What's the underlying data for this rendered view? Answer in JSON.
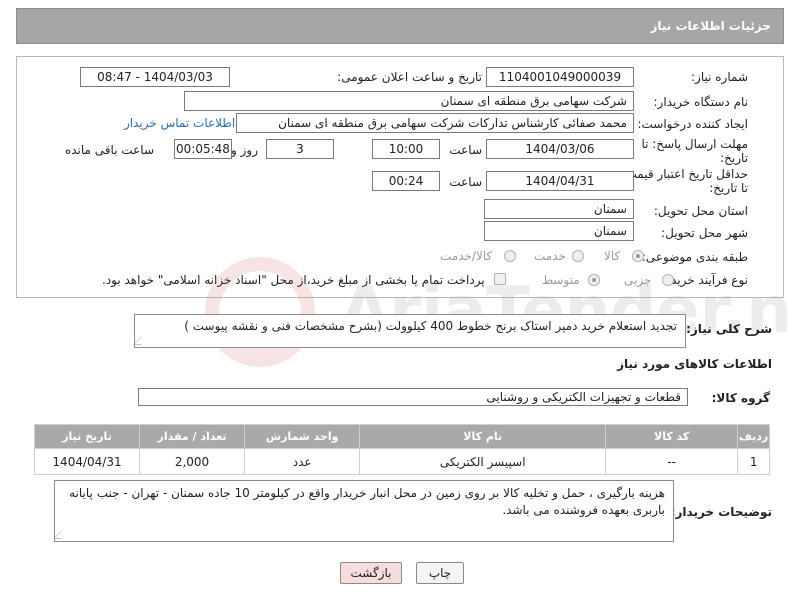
{
  "header": {
    "title": "جزئیات اطلاعات نیاز"
  },
  "form": {
    "need_number_label": "شماره نیاز:",
    "need_number": "1104001049000039",
    "announce_label": "تاریخ و ساعت اعلان عمومی:",
    "announce_value": "1404/03/03 - 08:47",
    "buyer_org_label": "نام دستگاه خریدار:",
    "buyer_org": "شرکت سهامی برق منطقه ای سمنان",
    "creator_label": "ایجاد کننده درخواست:",
    "creator": "محمد صفائی کارشناس تدارکات شرکت سهامی برق منطقه ای سمنان",
    "contact_link": "اطلاعات تماس خریدار",
    "reply_deadline_label_1": "مهلت ارسال پاسخ: تا",
    "reply_deadline_label_2": "تاریخ:",
    "reply_date": "1404/03/06",
    "time_label": "ساعت",
    "reply_time": "10:00",
    "days_value": "3",
    "days_label": "روز و",
    "remaining_time": "00:05:48",
    "remaining_label": "ساعت باقی مانده",
    "min_validity_label_1": "حداقل تاریخ اعتبار قیمت:",
    "min_validity_label_2": "تا تاریخ:",
    "validity_date": "1404/04/31",
    "validity_time": "00:24",
    "province_label": "استان محل تحویل:",
    "province": "سمنان",
    "city_label": "شهر محل تحویل:",
    "city": "سمنان",
    "category_label": "طبقه بندی موضوعی:",
    "category_options": [
      "کالا",
      "خدمت",
      "کالا/خدمت"
    ],
    "process_label": "نوع فرآیند خرید :",
    "process_options": [
      "جزیی",
      "متوسط"
    ],
    "payment_note": "پرداخت تمام یا بخشی از مبلغ خرید،از محل \"اسناد خزانه اسلامی\" خواهد بود."
  },
  "description": {
    "label": "شرح کلی نیاز:",
    "text": "تجدید استعلام خرید دمپر استاک برنج خطوط 400 کیلوولت (بشرح مشخصات فنی و نقشه پیوست )"
  },
  "goods": {
    "section_title": "اطلاعات کالاهای مورد نیاز",
    "group_label": "گروه کالا:",
    "group_value": "قطعات و تجهیزات الکتریکی و روشنایی",
    "columns": [
      "ردیف",
      "کد کالا",
      "نام کالا",
      "واحد شمارش",
      "تعداد / مقدار",
      "تاریخ نیاز"
    ],
    "rows": [
      [
        "1",
        "--",
        "اسپیسر الکتریکی",
        "عدد",
        "2,000",
        "1404/04/31"
      ]
    ]
  },
  "buyer_notes": {
    "label": "توضیحات خریدار:",
    "text": "هزینه بارگیری ، حمل  و تخلیه کالا بر روی زمین در محل انبار خریدار واقع در کیلومتر 10 جاده سمنان - تهران - جنب پایانه باربری بعهده فروشنده می باشد."
  },
  "buttons": {
    "print": "چاپ",
    "back": "بازگشت"
  },
  "watermark": {
    "text": "AriaTender.neT"
  },
  "colors": {
    "header_bg": "#a6a6a6",
    "link": "#2a6db5",
    "back_button_bg": "#f6dcdc"
  }
}
